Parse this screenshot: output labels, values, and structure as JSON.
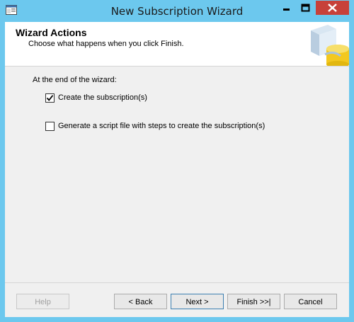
{
  "window": {
    "title": "New Subscription Wizard",
    "icons": {
      "app": "wizard-app-icon",
      "minimize": "minimize-icon",
      "maximize": "maximize-icon",
      "close": "close-icon"
    }
  },
  "header": {
    "title": "Wizard Actions",
    "subtitle": "Choose what happens when you click Finish.",
    "art_icon": "database-subscription-icon"
  },
  "content": {
    "section_label": "At the end of the wizard:",
    "options": [
      {
        "label": "Create the subscription(s)",
        "checked": true
      },
      {
        "label": "Generate a script file with steps to create the subscription(s)",
        "checked": false
      }
    ]
  },
  "buttons": {
    "help": "Help",
    "back": "< Back",
    "next": "Next >",
    "finish": "Finish >>|",
    "cancel": "Cancel"
  },
  "colors": {
    "title_bar": "#6cc8ee",
    "close_button": "#c7413a",
    "dialog_background": "#f0f0f0",
    "header_background": "#ffffff"
  }
}
